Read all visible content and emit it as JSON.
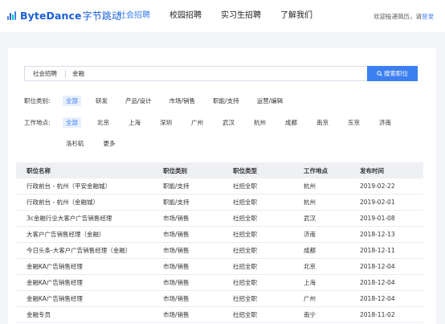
{
  "brand": {
    "name": "ByteDance",
    "name_cn": "字节跳动",
    "bar_colors": [
      "#3c7ff0",
      "#1a5fd8",
      "#00c4b6",
      "#3c7ff0"
    ]
  },
  "nav": {
    "items": [
      {
        "label": "社会招聘",
        "active": true
      },
      {
        "label": "校园招聘",
        "active": false
      },
      {
        "label": "实习生招聘",
        "active": false
      },
      {
        "label": "了解我们",
        "active": false
      }
    ]
  },
  "topright": {
    "welcome": "欢迎投递简历，请",
    "login": "登录"
  },
  "search": {
    "category": "社会招聘",
    "value": "金融",
    "button_label": "搜索职位"
  },
  "filters": {
    "category_label": "职位类别:",
    "categories": [
      {
        "label": "全部",
        "selected": true
      },
      {
        "label": "研发",
        "selected": false
      },
      {
        "label": "产品/设计",
        "selected": false
      },
      {
        "label": "市场/销售",
        "selected": false
      },
      {
        "label": "职能/支持",
        "selected": false
      },
      {
        "label": "运营/编辑",
        "selected": false
      }
    ],
    "location_label": "工作地点:",
    "locations": [
      {
        "label": "全部",
        "selected": true
      },
      {
        "label": "北京",
        "selected": false
      },
      {
        "label": "上海",
        "selected": false
      },
      {
        "label": "深圳",
        "selected": false
      },
      {
        "label": "广州",
        "selected": false
      },
      {
        "label": "武汉",
        "selected": false
      },
      {
        "label": "杭州",
        "selected": false
      },
      {
        "label": "成都",
        "selected": false
      },
      {
        "label": "南京",
        "selected": false
      },
      {
        "label": "东京",
        "selected": false
      },
      {
        "label": "济南",
        "selected": false
      }
    ],
    "locations_row2": [
      {
        "label": "洛杉矶",
        "selected": false
      },
      {
        "label": "更多",
        "selected": false
      }
    ]
  },
  "table": {
    "headers": [
      "职位名称",
      "职位类别",
      "职位类型",
      "工作地点",
      "发布时间"
    ],
    "rows": [
      [
        "行政前台 - 杭州（平安金融城）",
        "职能/支持",
        "社招全职",
        "杭州",
        "2019-02-22"
      ],
      [
        "行政前台 - 杭州（金融城）",
        "职能/支持",
        "社招全职",
        "杭州",
        "2019-02-01"
      ],
      [
        "3c金融行业大客户广告销售经理",
        "市场/销售",
        "社招全职",
        "武汉",
        "2019-01-08"
      ],
      [
        "大客户广告销售经理（金融）",
        "市场/销售",
        "社招全职",
        "济南",
        "2018-12-13"
      ],
      [
        "今日头条-大客户广告销售经理（金融）",
        "市场/销售",
        "社招全职",
        "成都",
        "2018-12-11"
      ],
      [
        "金融KA广告销售经理",
        "市场/销售",
        "社招全职",
        "北京",
        "2018-12-04"
      ],
      [
        "金融KA广告销售经理",
        "市场/销售",
        "社招全职",
        "上海",
        "2018-12-04"
      ],
      [
        "金融KA广告销售经理",
        "市场/销售",
        "社招全职",
        "广州",
        "2018-12-04"
      ],
      [
        "金融专员",
        "市场/销售",
        "社招全职",
        "南宁",
        "2018-11-02"
      ]
    ]
  },
  "colors": {
    "accent": "#3c7ff0",
    "page_bg": "#f3f5f8",
    "chip_bg": "#e7effd"
  }
}
